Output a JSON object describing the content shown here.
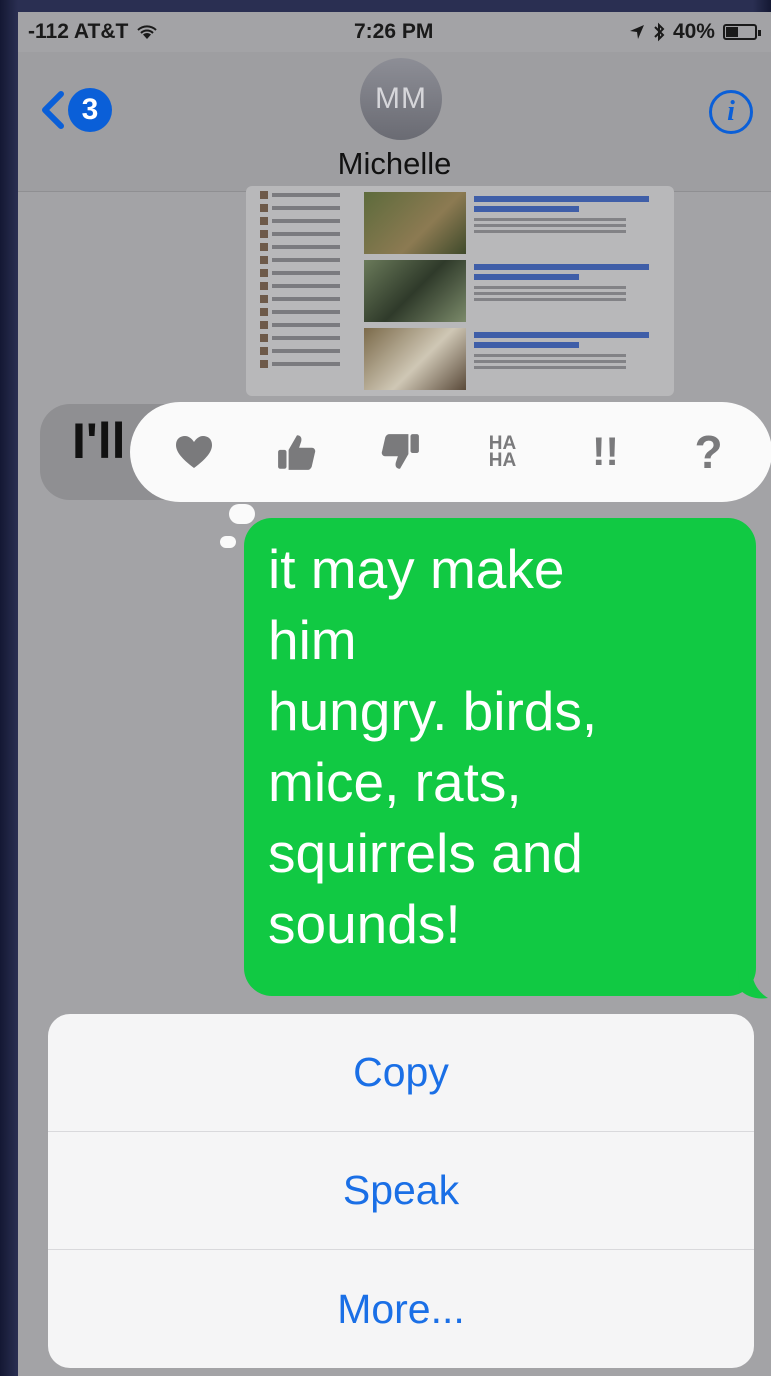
{
  "status_bar": {
    "carrier": "-112 AT&T",
    "time": "7:26 PM",
    "battery": "40%"
  },
  "nav": {
    "back_badge": "3",
    "avatar_initials": "MM",
    "contact_name": "Michelle",
    "info_glyph": "i"
  },
  "conversation": {
    "received_partial": "I'll",
    "sent_message": "it may make\nhim\nhungry.  birds,\nmice, rats,\nsquirrels and\nsounds!"
  },
  "tapback": {
    "items": [
      "heart-icon",
      "thumbs-up-icon",
      "thumbs-down-icon",
      "haha-icon",
      "exclamation-icon",
      "question-icon"
    ],
    "haha_text": "HA\nHA",
    "exclaim_text": "!!",
    "question_text": "?"
  },
  "menu": {
    "items": [
      "Copy",
      "Speak",
      "More..."
    ]
  },
  "colors": {
    "accent_blue": "#1a6fe6",
    "sent_green": "#11c943",
    "dim_overlay": "#a3a3a6"
  }
}
